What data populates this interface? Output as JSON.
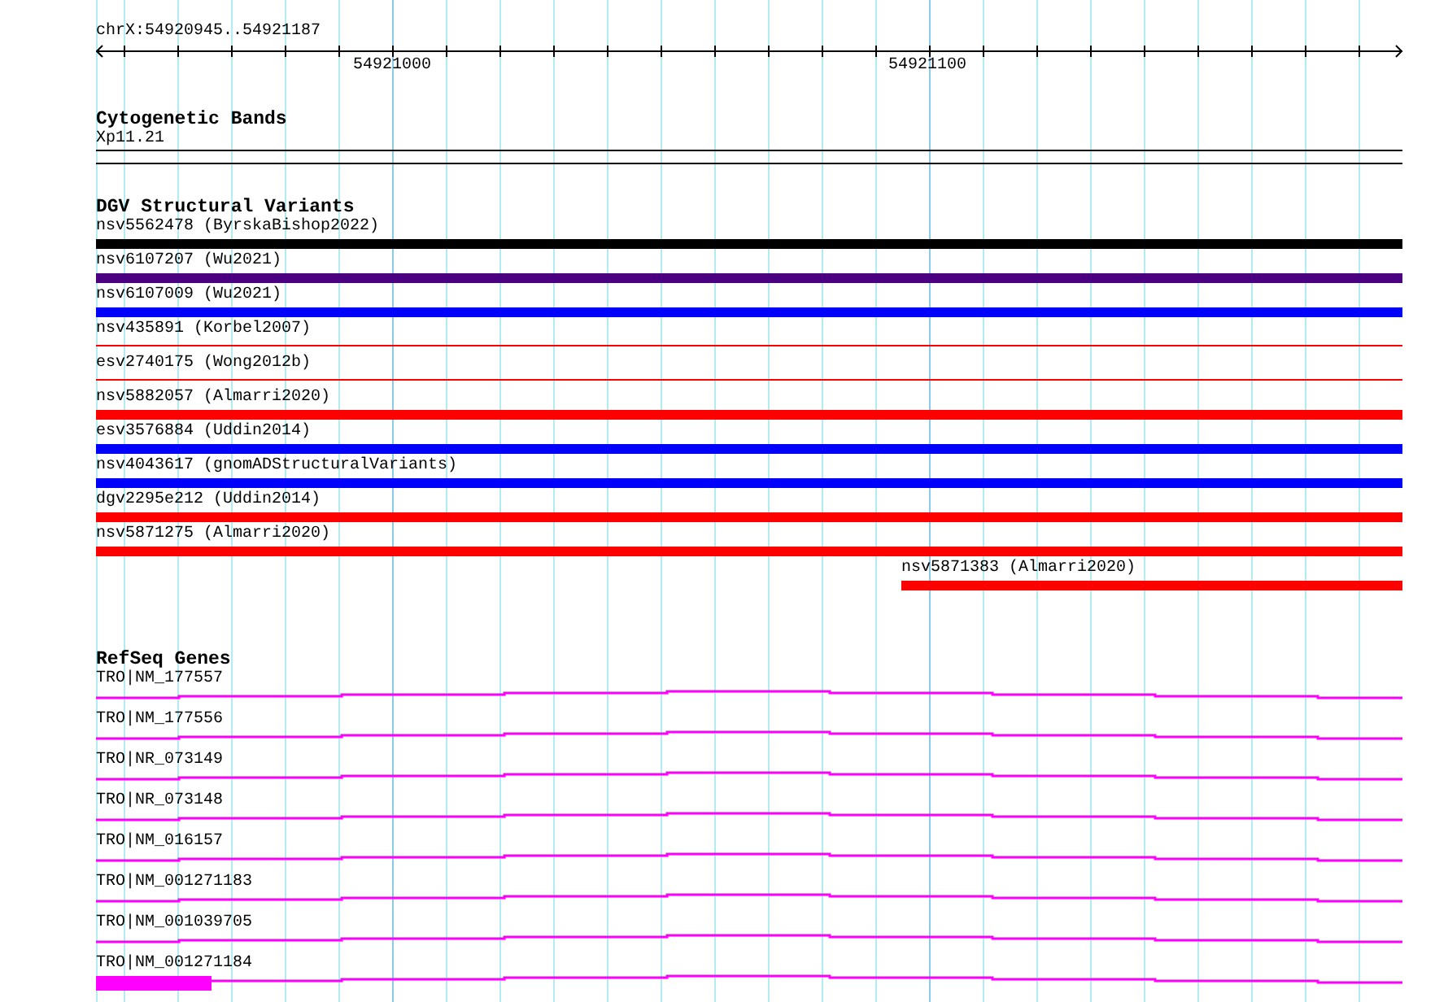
{
  "ruler": {
    "position": "chrX:54920945..54921187",
    "tick_labels": [
      "54921000",
      "54921100"
    ]
  },
  "cytogenetic_bands": {
    "title": "Cytogenetic Bands",
    "band_label": "Xp11.21"
  },
  "dgv": {
    "title": "DGV Structural Variants",
    "variants": [
      {
        "label": "nsv5562478 (ByrskaBishop2022)",
        "color": "#000000",
        "kind": "thick"
      },
      {
        "label": "nsv6107207 (Wu2021)",
        "color": "#4b0082",
        "kind": "thick"
      },
      {
        "label": "nsv6107009 (Wu2021)",
        "color": "#0000ff",
        "kind": "thick"
      },
      {
        "label": "nsv435891 (Korbel2007)",
        "color": "#ff0000",
        "kind": "thin"
      },
      {
        "label": "esv2740175 (Wong2012b)",
        "color": "#ff0000",
        "kind": "thin"
      },
      {
        "label": "nsv5882057 (Almarri2020)",
        "color": "#ff0000",
        "kind": "thick"
      },
      {
        "label": "esv3576884 (Uddin2014)",
        "color": "#0000ff",
        "kind": "thick"
      },
      {
        "label": "nsv4043617 (gnomADStructuralVariants)",
        "color": "#0000ff",
        "kind": "thick"
      },
      {
        "label": "dgv2295e212 (Uddin2014)",
        "color": "#ff0000",
        "kind": "thick"
      },
      {
        "label": "nsv5871275 (Almarri2020)",
        "color": "#ff0000",
        "kind": "thick"
      },
      {
        "label": "nsv5871383 (Almarri2020)",
        "color": "#ff0000",
        "kind": "partial"
      }
    ]
  },
  "refseq": {
    "title": "RefSeq Genes",
    "transcripts": [
      {
        "label": "TRO|NM_177557",
        "kind": "intron"
      },
      {
        "label": "TRO|NM_177556",
        "kind": "intron"
      },
      {
        "label": "TRO|NR_073149",
        "kind": "intron"
      },
      {
        "label": "TRO|NR_073148",
        "kind": "intron"
      },
      {
        "label": "TRO|NM_016157",
        "kind": "intron"
      },
      {
        "label": "TRO|NM_001271183",
        "kind": "intron"
      },
      {
        "label": "TRO|NM_001039705",
        "kind": "intron"
      },
      {
        "label": "TRO|NM_001271184",
        "kind": "exon_start"
      }
    ]
  }
}
